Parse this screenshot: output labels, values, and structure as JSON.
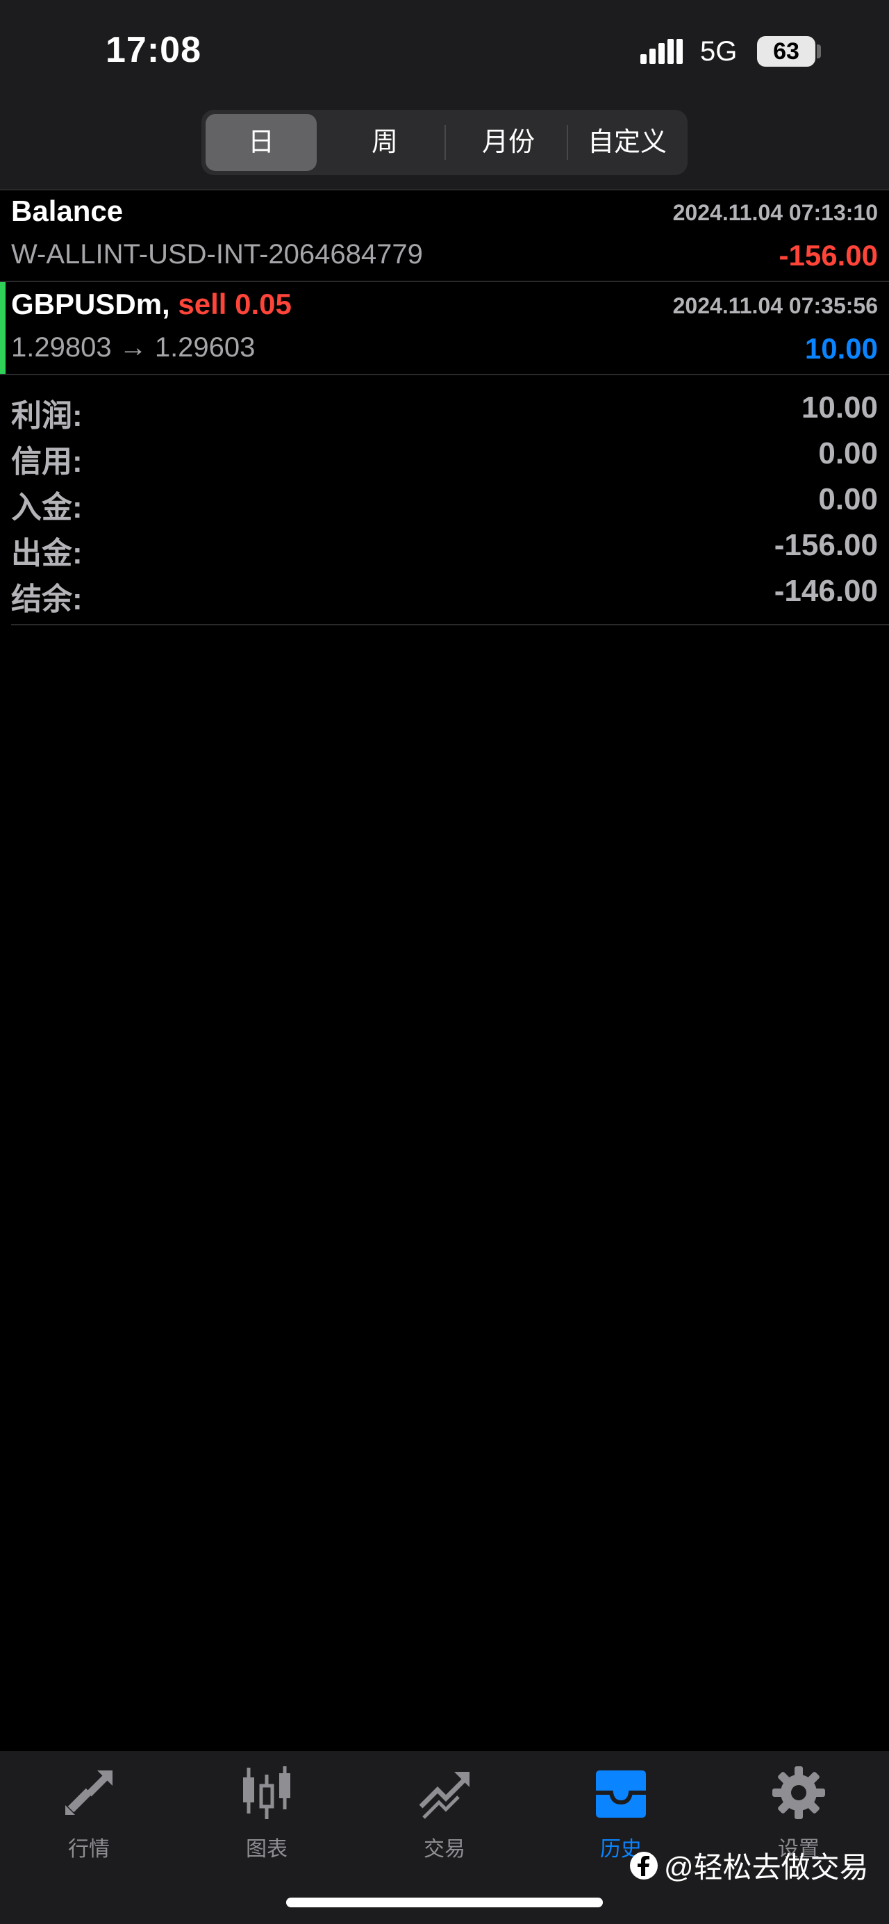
{
  "status_bar": {
    "time": "17:08",
    "network": "5G",
    "battery": "63"
  },
  "segmented": {
    "items": [
      "日",
      "周",
      "月份",
      "自定义"
    ],
    "selected": "日"
  },
  "history": [
    {
      "title": "Balance",
      "subtitle": "W-ALLINT-USD-INT-2064684779",
      "time": "2024.11.04 07:13:10",
      "amount": "-156.00"
    },
    {
      "symbol": "GBPUSDm,",
      "action": "sell 0.05",
      "prices": "1.29803 → 1.29603",
      "time": "2024.11.04 07:35:56",
      "amount": "10.00"
    }
  ],
  "summary": [
    {
      "label": "利润:",
      "value": "10.00"
    },
    {
      "label": "信用:",
      "value": "0.00"
    },
    {
      "label": "入金:",
      "value": "0.00"
    },
    {
      "label": "出金:",
      "value": "-156.00"
    },
    {
      "label": "结余:",
      "value": "-146.00"
    }
  ],
  "tabs": [
    {
      "label": "行情",
      "icon": "quotes-arrows-icon"
    },
    {
      "label": "图表",
      "icon": "candlestick-icon"
    },
    {
      "label": "交易",
      "icon": "trade-trend-icon"
    },
    {
      "label": "历史",
      "icon": "history-inbox-icon",
      "active": true
    },
    {
      "label": "设置",
      "icon": "gear-icon"
    }
  ],
  "watermark": "@轻松去做交易",
  "colors": {
    "negative": "#ff453a",
    "positive": "#0a84ff",
    "accent": "#30d158"
  }
}
